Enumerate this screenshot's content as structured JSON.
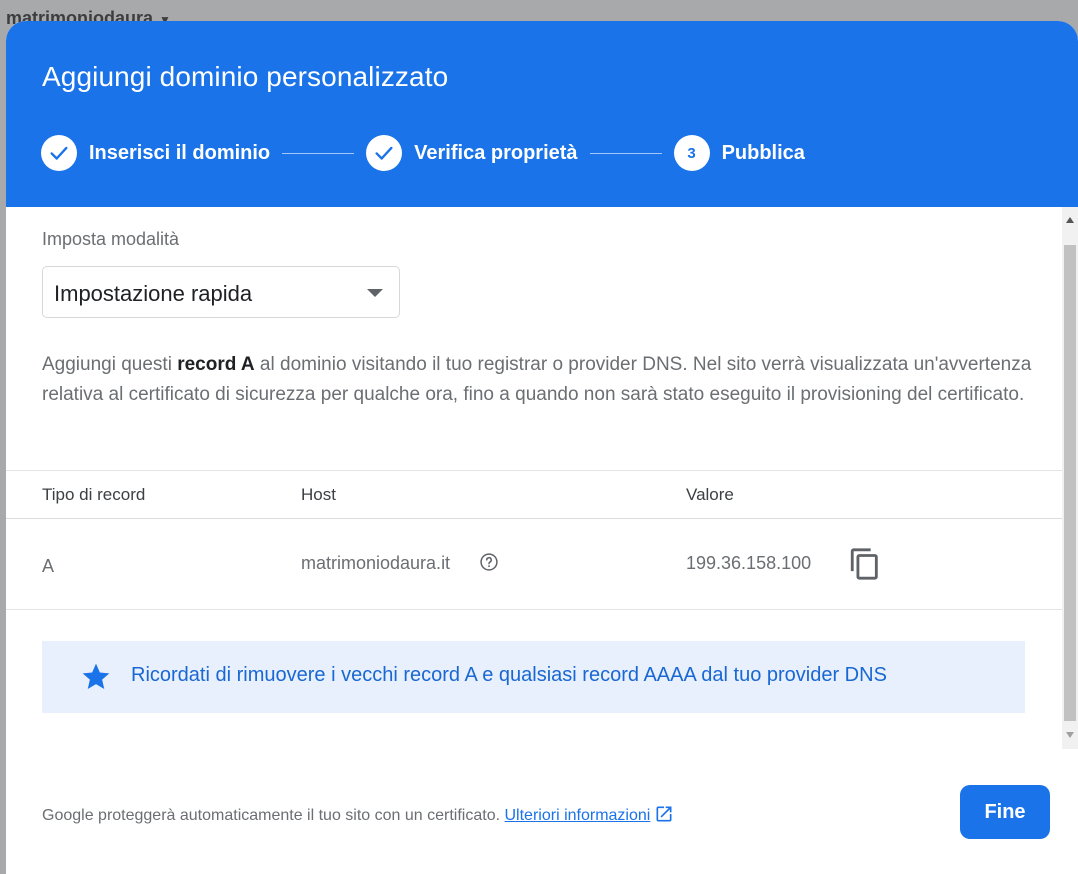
{
  "background": {
    "site_name": "matrimoniodaura"
  },
  "dialog": {
    "title": "Aggiungi dominio personalizzato",
    "steps": [
      {
        "label": "Inserisci il dominio",
        "state": "done"
      },
      {
        "label": "Verifica proprietà",
        "state": "done"
      },
      {
        "label": "Pubblica",
        "number": "3",
        "state": "active"
      }
    ],
    "mode_label": "Imposta modalità",
    "mode_select": {
      "value": "Impostazione rapida"
    },
    "description": {
      "before": "Aggiungi questi ",
      "bold": "record A",
      "after": " al dominio visitando il tuo registrar o provider DNS. Nel sito verrà visualizzata un'avvertenza relativa al certificato di sicurezza per qualche ora, fino a quando non sarà stato eseguito il provisioning del certificato."
    },
    "table": {
      "headers": [
        "Tipo di record",
        "Host",
        "Valore"
      ],
      "rows": [
        {
          "type": "A",
          "host": "matrimoniodaura.it",
          "value": "199.36.158.100"
        }
      ]
    },
    "banner": {
      "icon": "star-icon",
      "text": "Ricordati di rimuovere i vecchi record A e qualsiasi record AAAA dal tuo provider DNS"
    },
    "footer": {
      "text": "Google proteggerà automaticamente il tuo sito con un certificato.",
      "link": "Ulteriori informazioni"
    },
    "done_button": "Fine"
  },
  "colors": {
    "primary": "#1a73e8",
    "banner_bg": "#e8f0fd",
    "text_muted": "#6b6e72"
  }
}
